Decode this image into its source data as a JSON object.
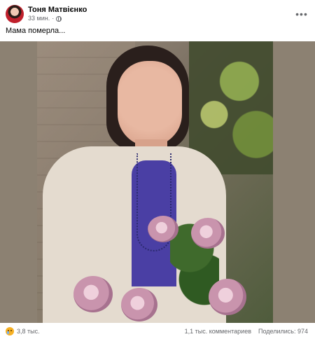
{
  "post": {
    "author": "Тоня Матвієнко",
    "time": "33 мин.",
    "visibility_icon": "globe-icon",
    "more_icon": "more-icon",
    "text": "Мама померла..."
  },
  "footer": {
    "reaction_icon": "sad-reaction-icon",
    "reactions_count": "3,8 тыс.",
    "comments": "1,1 тыс. комментариев",
    "shares": "Поделились: 974"
  },
  "colors": {
    "text_primary": "#050505",
    "text_secondary": "#65676b",
    "media_background": "#8c8172"
  }
}
